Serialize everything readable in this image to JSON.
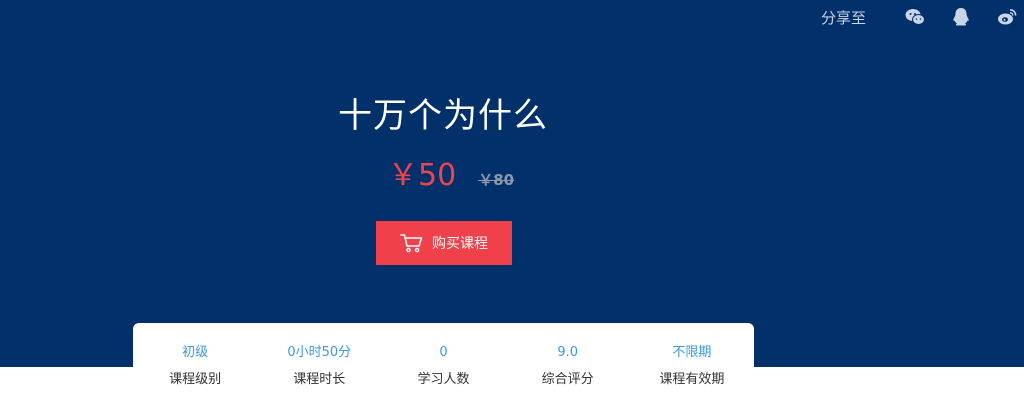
{
  "share": {
    "label": "分享至",
    "icons": [
      "wechat-icon",
      "qq-icon",
      "weibo-icon"
    ]
  },
  "course": {
    "title": "十万个为什么",
    "price_now": "￥50",
    "price_old": "￥80",
    "buy_label": "购买课程"
  },
  "stats": [
    {
      "value": "初级",
      "label": "课程级别"
    },
    {
      "value": "0小时50分",
      "label": "课程时长"
    },
    {
      "value": "0",
      "label": "学习人数"
    },
    {
      "value": "9.0",
      "label": "综合评分"
    },
    {
      "value": "不限期",
      "label": "课程有效期"
    }
  ],
  "colors": {
    "hero_bg": "#01306b",
    "price": "#ee4450",
    "button": "#f0414b",
    "stat_value": "#3b99e6"
  }
}
